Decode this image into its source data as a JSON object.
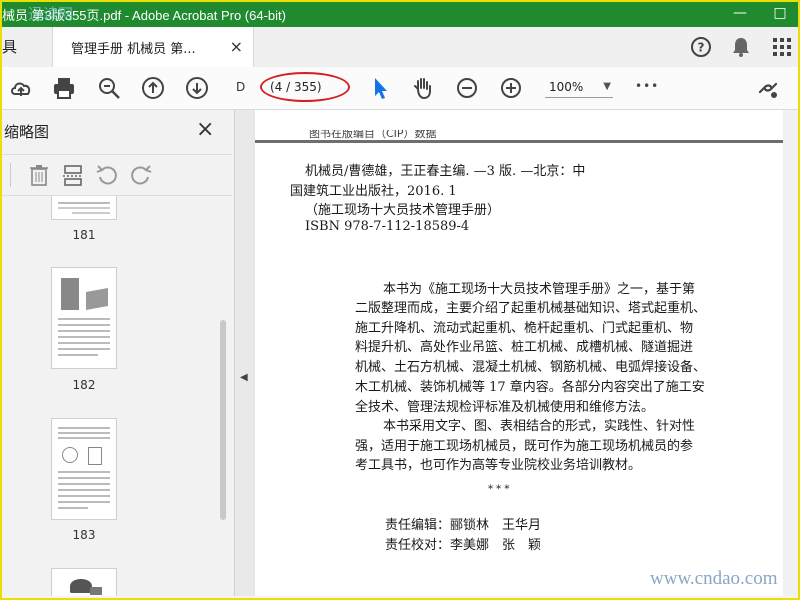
{
  "window": {
    "title": "械员 第3版355页.pdf - Adobe Acrobat Pro (64-bit)",
    "watermark_top": "迅读网",
    "minimize": "—",
    "maximize": "□"
  },
  "tabs": {
    "tools_label": "具",
    "document_tab": "管理手册 机械员 第...",
    "close": "×"
  },
  "toolbar": {
    "page_prefix": "D",
    "page_indicator": "(4 / 355)",
    "zoom": "100%",
    "more": "•••"
  },
  "sidebar": {
    "title": "缩略图",
    "close": "×",
    "thumbnails": [
      {
        "page": "181"
      },
      {
        "page": "182"
      },
      {
        "page": "183"
      },
      {
        "page": ""
      }
    ]
  },
  "document": {
    "top_cut_text": "图书在版编目（CIP）数据",
    "cip_lines": [
      "机械员/曹德雄，王正春主编. —3 版. —北京：中",
      "国建筑工业出版社，2016. 1",
      "（施工现场十大员技术管理手册）",
      "ISBN 978-7-112-18589-4"
    ],
    "body_lines": [
      "本书为《施工现场十大员技术管理手册》之一，基于第",
      "二版整理而成，主要介绍了起重机械基础知识、塔式起重机、",
      "施工升降机、流动式起重机、桅杆起重机、门式起重机、物",
      "料提升机、高处作业吊篮、桩工机械、成槽机械、隧道掘进",
      "机械、土石方机械、混凝土机械、钢筋机械、电弧焊接设备、",
      "木工机械、装饰机械等 17 章内容。各部分内容突出了施工安",
      "全技术、管理法规检评标准及机械使用和维修方法。",
      "本书采用文字、图、表相结合的形式，实践性、针对性",
      "强，适用于施工现场机械员，既可作为施工现场机械员的参",
      "考工具书，也可作为高等专业院校业务培训教材。"
    ],
    "stars": "*          *          *",
    "editor": "责任编辑：郦锁林　王华月",
    "proofreader": "责任校对：李美娜　张　颖"
  },
  "watermark_bottom": "www.cndao.com",
  "colors": {
    "titlebar": "#1f8a2e",
    "frame": "#e8e000",
    "accent_blue": "#1473e6",
    "highlight_red": "#d62020"
  }
}
